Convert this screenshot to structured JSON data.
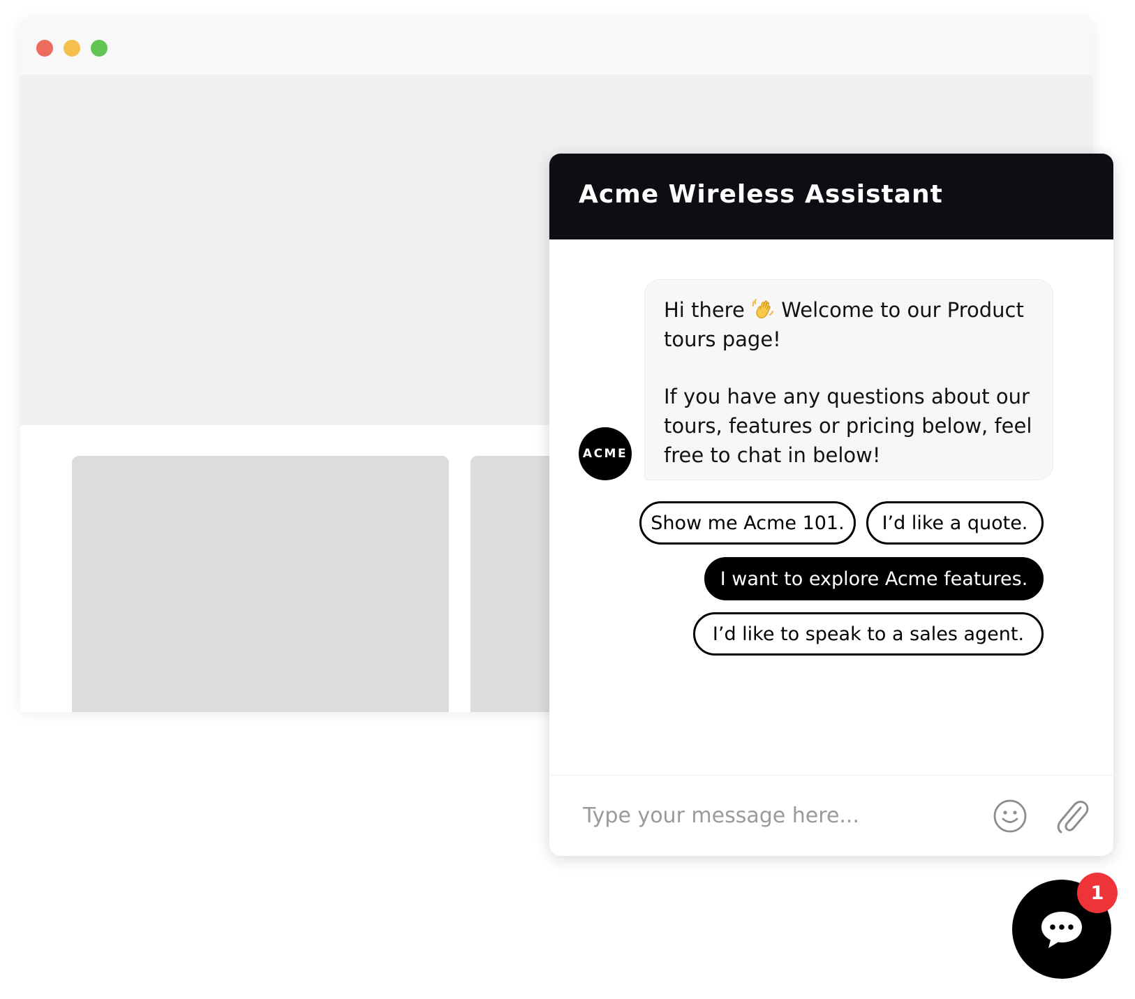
{
  "browser": {
    "traffic_lights": {
      "close": "#ec6a5e",
      "minimize": "#f4bf4f",
      "maximize": "#61c554"
    },
    "colors": {
      "titlebar": "#f8f8f9",
      "hero": "#f0f0f0",
      "card": "#dcdcdc"
    }
  },
  "chat": {
    "title": "Acme Wireless Assistant",
    "avatar_label": "ACME",
    "message": {
      "line1_before_emoji": "Hi there ",
      "emoji": "waving-hand",
      "line1_after_emoji": " Welcome to our Product tours page!",
      "paragraph2": "If you have any questions about our tours, features or pricing below, feel free to chat in below!"
    },
    "quick_replies": [
      {
        "label": "Show me Acme 101.",
        "selected": false
      },
      {
        "label": "I’d like a quote.",
        "selected": false
      },
      {
        "label": "I want to explore Acme features.",
        "selected": true
      },
      {
        "label": "I’d like to speak to a sales agent.",
        "selected": false
      }
    ],
    "composer": {
      "placeholder": "Type your message here...",
      "emoji_icon": "smiley-icon",
      "attach_icon": "paperclip-icon"
    },
    "colors": {
      "header": "#0d0e14",
      "bubble": "#f7f7f8"
    }
  },
  "launcher": {
    "icon": "chat-bubble-icon",
    "badge_count": "1",
    "badge_color": "#ee3339"
  }
}
